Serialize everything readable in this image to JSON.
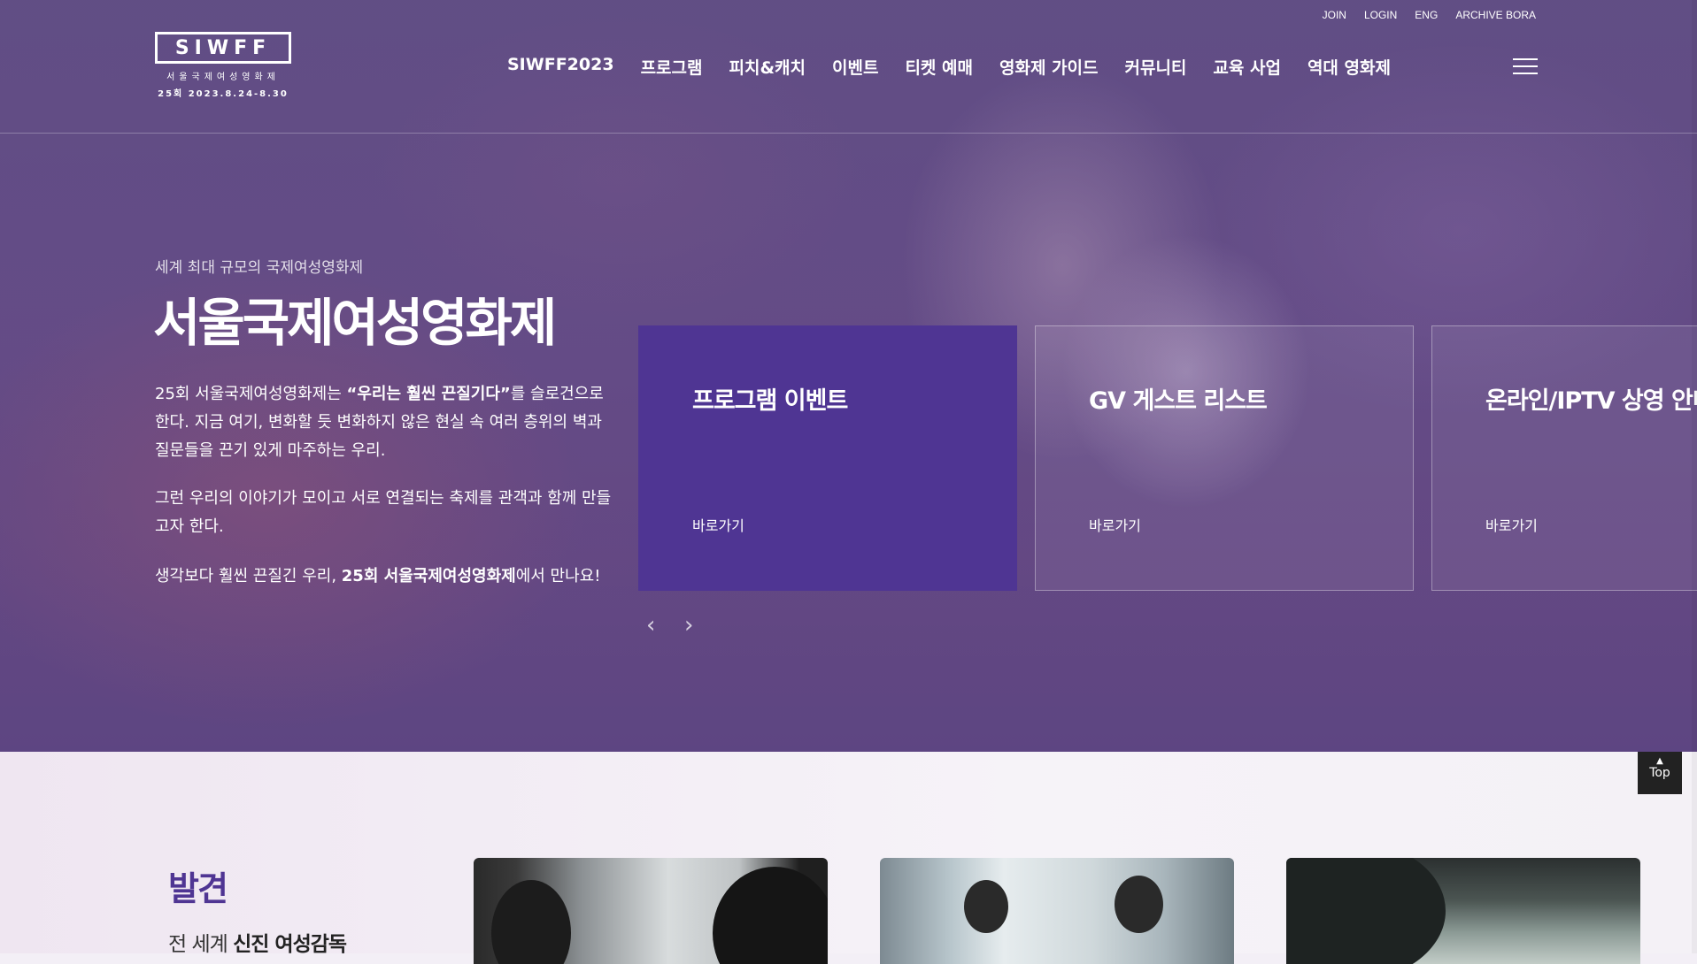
{
  "header": {
    "logo": {
      "mark": "SIWFF",
      "subtitle": "서울국제여성영화제",
      "edition": "25회  2023.8.24-8.30"
    },
    "util_links": [
      "JOIN",
      "LOGIN",
      "ENG",
      "ARCHIVE BORA"
    ],
    "nav": [
      "SIWFF2023",
      "프로그램",
      "피치&캐치",
      "이벤트",
      "티켓 예매",
      "영화제 가이드",
      "커뮤니티",
      "교육 사업",
      "역대 영화제"
    ],
    "menu_icon": "hamburger-icon"
  },
  "hero": {
    "eyebrow": "세계 최대 규모의 국제여성영화제",
    "title": "서울국제여성영화제",
    "para1_prefix": "25회 서울국제여성영화제는 ",
    "para1_bold": "“우리는 훨씬 끈질기다”",
    "para1_suffix": "를 슬로건으로 한다. 지금 여기, 변화할 듯 변화하지 않은 현실 속 여러 층위의 벽과 질문들을 끈기 있게 마주하는 우리.",
    "para2": "그런 우리의 이야기가 모이고 서로 연결되는 축제를 관객과 함께 만들고자 한다.",
    "para3_prefix": "생각보다 훨씬 끈질긴 우리, ",
    "para3_bold": "25회 서울국제여성영화제",
    "para3_suffix": "에서 만나요!",
    "cards": [
      {
        "title": "프로그램 이벤트",
        "link": "바로가기",
        "active": true
      },
      {
        "title": "GV 게스트 리스트",
        "link": "바로가기",
        "active": false
      },
      {
        "title": "온라인/IPTV 상영 안내",
        "link": "바로가기",
        "active": false
      }
    ],
    "prev_icon": "‹",
    "next_icon": "›"
  },
  "section": {
    "title": "발견",
    "subtitle_prefix": "전 세계 ",
    "subtitle_bold": "신진 여성감독"
  },
  "top_button": {
    "label": "Top",
    "icon": "▲"
  },
  "colors": {
    "brand_purple": "#4f3593"
  }
}
